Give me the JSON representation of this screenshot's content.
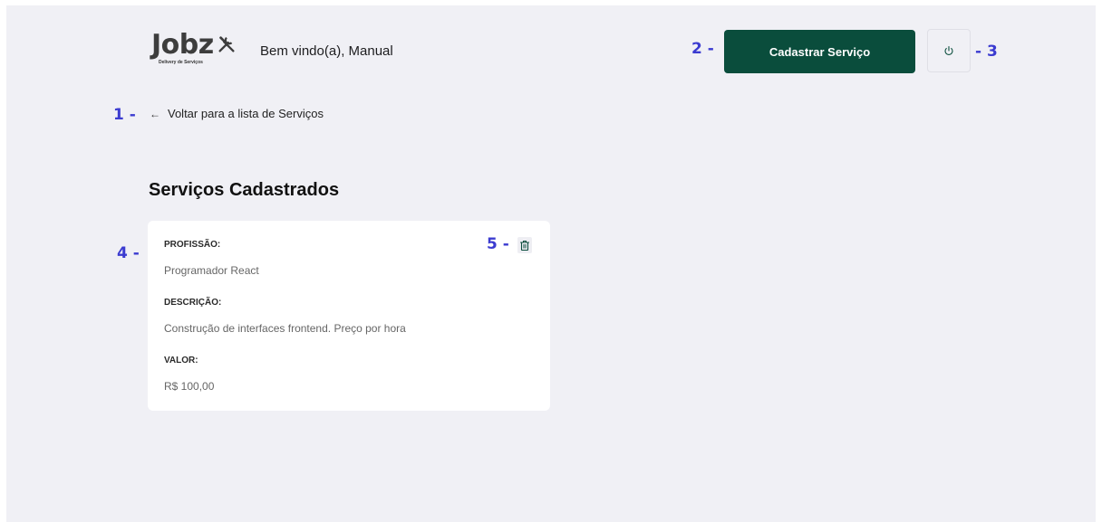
{
  "header": {
    "logo_text": "Jobz",
    "logo_subtitle": "Delivery de Serviços",
    "welcome": "Bem vindo(a), Manual",
    "register_button": "Cadastrar Serviço",
    "logout_icon": "power-icon"
  },
  "back_link": {
    "icon": "arrow-left-icon",
    "label": "Voltar para a lista de Serviços"
  },
  "section": {
    "title": "Serviços Cadastrados"
  },
  "services": [
    {
      "profession_label": "PROFISSÃO:",
      "profession": "Programador React",
      "description_label": "DESCRIÇÃO:",
      "description": "Construção de interfaces frontend. Preço por hora",
      "value_label": "VALOR:",
      "value": "R$ 100,00",
      "delete_icon": "trash-icon"
    }
  ],
  "annotations": {
    "a1": "1 -",
    "a2": "2 -",
    "a3": "- 3",
    "a4": "4 -",
    "a5": "5 -"
  },
  "colors": {
    "background": "#f0f0f5",
    "primary": "#0a4d3c",
    "annotation": "#3b3bd0",
    "card": "#ffffff"
  }
}
